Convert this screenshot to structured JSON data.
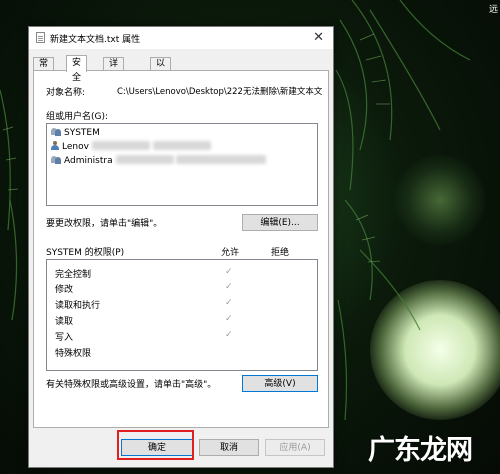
{
  "desktop": {
    "corner_label": "远",
    "watermark": "广东龙网"
  },
  "dialog": {
    "title": "新建文本文档.txt 属性",
    "close_label": "✕",
    "tabs": [
      "常规",
      "安全",
      "详细信息",
      "以前的版本"
    ],
    "active_tab": "安全",
    "object_label": "对象名称:",
    "object_value": "C:\\Users\\Lenovo\\Desktop\\222无法删除\\新建文本文",
    "group_label": "组或用户名(G):",
    "users": [
      {
        "name": "SYSTEM",
        "icon": "group-icon"
      },
      {
        "name": "Lenov",
        "icon": "user-icon"
      },
      {
        "name": "Administra",
        "icon": "group-icon"
      }
    ],
    "edit_hint": "要更改权限，请单击\"编辑\"。",
    "edit_button": "编辑(E)...",
    "perm_title": "SYSTEM 的权限(P)",
    "allow_col": "允许",
    "deny_col": "拒绝",
    "permissions": [
      {
        "name": "完全控制",
        "allow": "✓"
      },
      {
        "name": "修改",
        "allow": "✓"
      },
      {
        "name": "读取和执行",
        "allow": "✓"
      },
      {
        "name": "读取",
        "allow": "✓"
      },
      {
        "name": "写入",
        "allow": "✓"
      },
      {
        "name": "特殊权限",
        "allow": ""
      }
    ],
    "advanced_hint": "有关特殊权限或高级设置，请单击\"高级\"。",
    "advanced_button": "高级(V)",
    "ok_button": "确定",
    "cancel_button": "取消",
    "apply_button": "应用(A)"
  }
}
